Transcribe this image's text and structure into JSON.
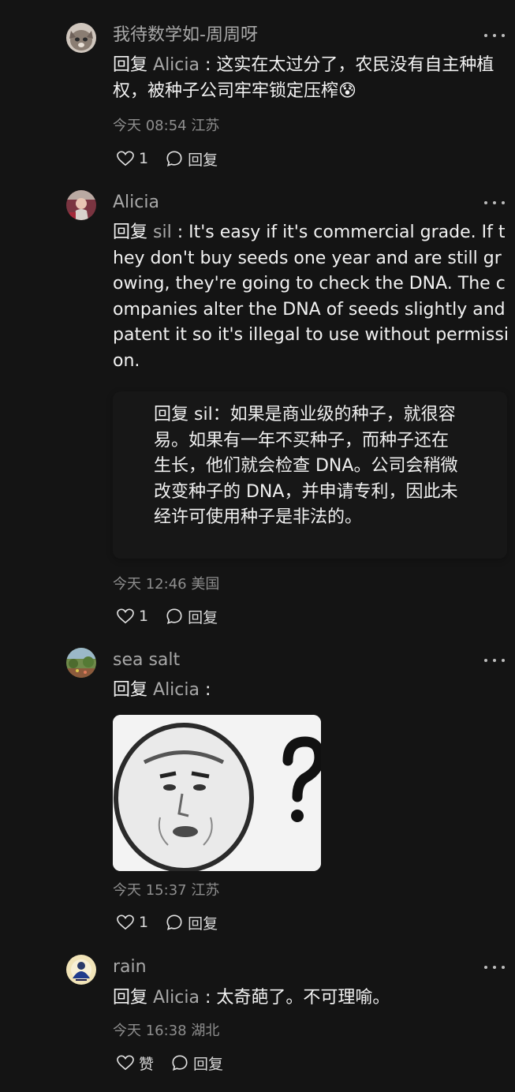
{
  "comments": [
    {
      "username": "我待数学如-周周呀",
      "reply_word": "回复",
      "mention": "Alicia",
      "colon": " : ",
      "body": "这实在太过分了，农民没有自主种植权，被种子公司牢牢锁定压榨",
      "emoji": "😰",
      "time": "今天 08:54 江苏",
      "likes": "1",
      "reply_label": "回复"
    },
    {
      "username": "Alicia",
      "reply_word": "回复",
      "mention": "sil",
      "colon": " : ",
      "body": "It's easy if it's commercial grade. If they don't buy seeds one year and are still growing, they're going to check the DNA. The companies alter the DNA of seeds slightly and patent it so it's illegal to use without permission.",
      "translation": "回复 sil：如果是商业级的种子，就很容易。如果有一年不买种子，而种子还在生长，他们就会检查 DNA。公司会稍微改变种子的 DNA，并申请专利，因此未经许可使用种子是非法的。",
      "time": "今天 12:46 美国",
      "likes": "1",
      "reply_label": "回复"
    },
    {
      "username": "sea salt",
      "reply_word": "回复",
      "mention": "Alicia",
      "colon": " :",
      "image": "confused-face-meme",
      "time": "今天 15:37 江苏",
      "likes": "1",
      "reply_label": "回复"
    },
    {
      "username": "rain",
      "reply_word": "回复",
      "mention": "Alicia",
      "colon": " : ",
      "body": "太奇葩了。不可理喻。",
      "time": "今天 16:38 湖北",
      "likes": "赞",
      "reply_label": "回复"
    }
  ],
  "icons": {
    "more": "more-dots-icon",
    "like": "heart-outline-icon",
    "reply": "speech-bubble-icon"
  },
  "colors": {
    "background": "#141414",
    "text": "#f2f2f2",
    "secondary": "#a8a8a8",
    "meta": "#8e8e8e"
  }
}
